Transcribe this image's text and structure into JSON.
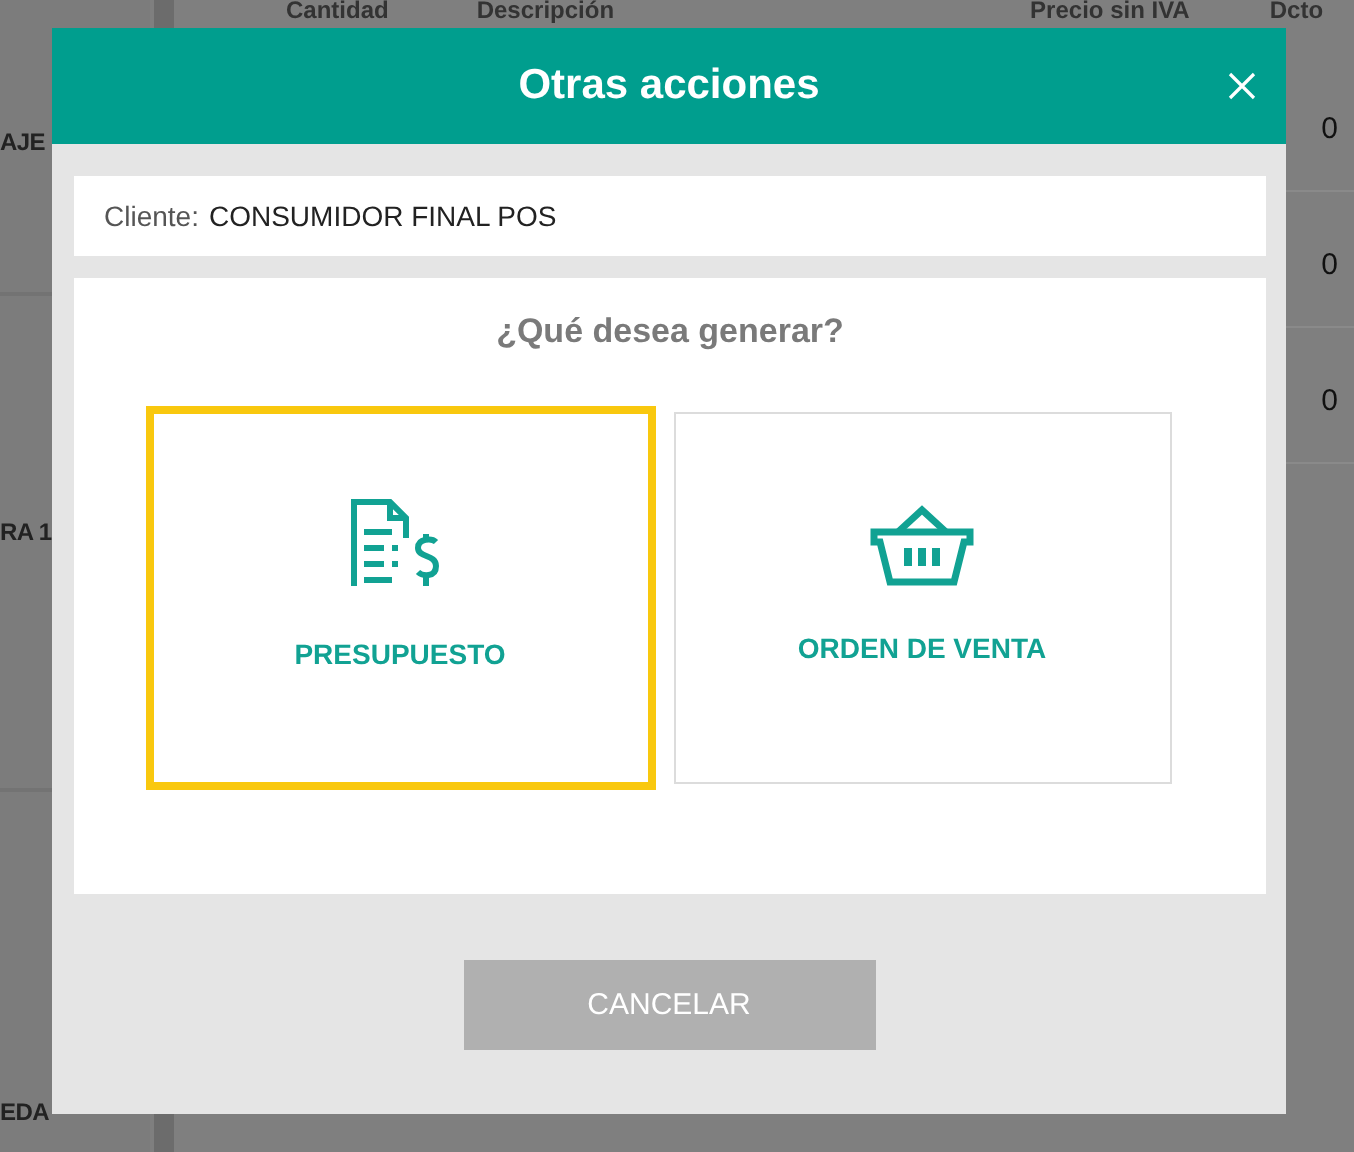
{
  "background": {
    "columns": [
      "Cantidad",
      "Descripción",
      "Precio sin IVA",
      "Dcto"
    ],
    "side_labels": [
      "AJE",
      "RA 1",
      "EDA"
    ],
    "row_values": [
      "0",
      "0",
      "0"
    ]
  },
  "dialog": {
    "title": "Otras acciones",
    "client_label": "Cliente:",
    "client_value": "CONSUMIDOR FINAL POS",
    "question": "¿Qué desea generar?",
    "options": [
      {
        "label": "PRESUPUESTO",
        "kind": "quote",
        "selected": true
      },
      {
        "label": "ORDEN DE VENTA",
        "kind": "basket",
        "selected": false
      }
    ],
    "cancel": "CANCELAR"
  }
}
